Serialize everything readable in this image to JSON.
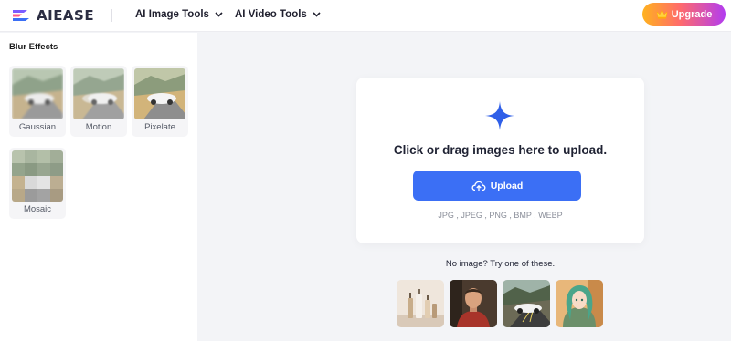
{
  "header": {
    "brand": "AIEASE",
    "nav": [
      {
        "label": "AI Image Tools"
      },
      {
        "label": "AI Video Tools"
      }
    ],
    "upgrade_label": "Upgrade"
  },
  "sidebar": {
    "title": "Blur Effects",
    "effects": [
      {
        "label": "Gaussian"
      },
      {
        "label": "Motion"
      },
      {
        "label": "Pixelate"
      },
      {
        "label": "Mosaic"
      }
    ]
  },
  "upload": {
    "prompt": "Click or drag images here to upload.",
    "button_label": "Upload",
    "formats": "JPG , JPEG , PNG , BMP , WEBP"
  },
  "samples": {
    "label": "No image? Try one of these.",
    "items": [
      "sample-bottles",
      "sample-man",
      "sample-car",
      "sample-anime-girl"
    ]
  },
  "colors": {
    "accent": "#3b6ff5",
    "upgrade_gradient": [
      "#ffb21e",
      "#ff6b6b",
      "#b23cf0"
    ],
    "page_background": "#f3f4f7"
  },
  "icons": [
    "logo-icon",
    "chevron-down-icon",
    "crown-icon",
    "plus-sparkle-icon",
    "cloud-upload-icon"
  ]
}
